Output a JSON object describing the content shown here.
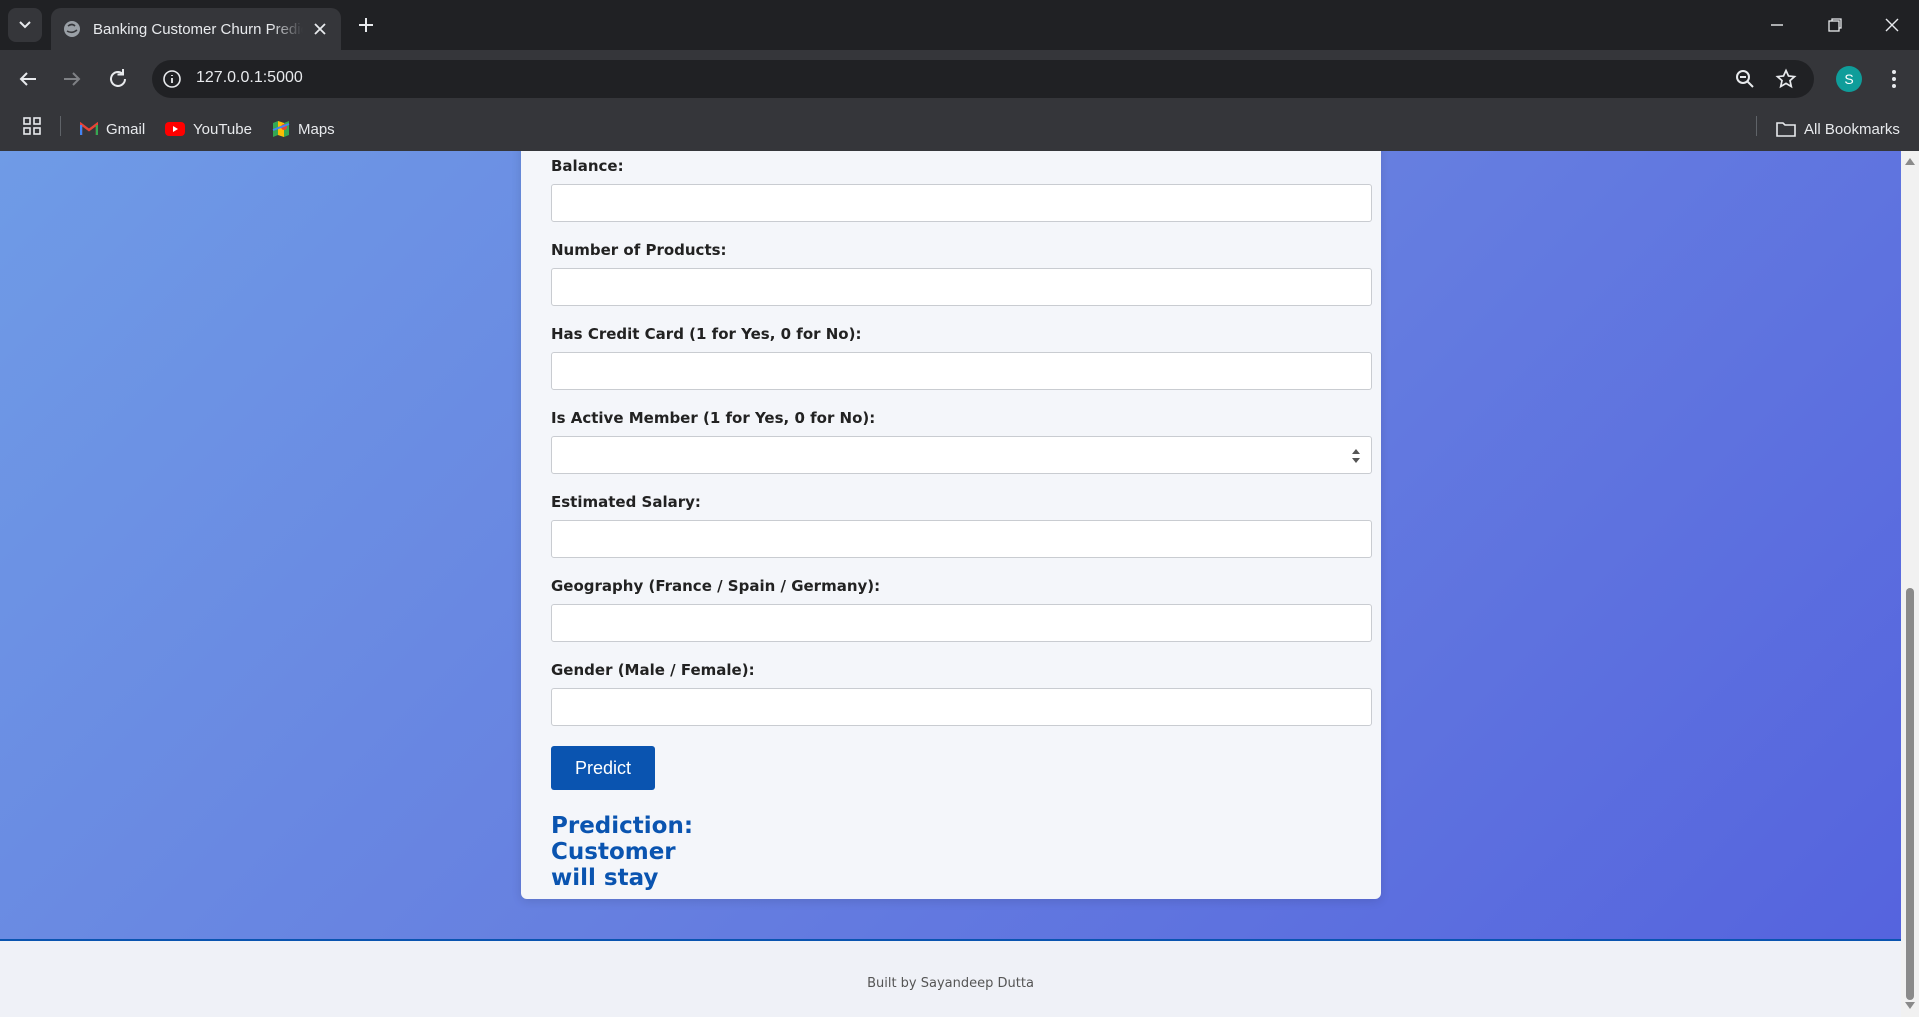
{
  "browser": {
    "tab_title": "Banking Customer Churn Prediction",
    "url": "127.0.0.1:5000",
    "profile_initial": "S",
    "bookmarks": [
      {
        "label": "Gmail"
      },
      {
        "label": "YouTube"
      },
      {
        "label": "Maps"
      }
    ],
    "all_bookmarks_label": "All Bookmarks"
  },
  "form": {
    "fields": [
      {
        "label": "Balance:",
        "value": ""
      },
      {
        "label": "Number of Products:",
        "value": ""
      },
      {
        "label": "Has Credit Card (1 for Yes, 0 for No):",
        "value": ""
      },
      {
        "label": "Is Active Member (1 for Yes, 0 for No):",
        "value": ""
      },
      {
        "label": "Estimated Salary:",
        "value": ""
      },
      {
        "label": "Geography (France / Spain / Germany):",
        "value": ""
      },
      {
        "label": "Gender (Male / Female):",
        "value": ""
      }
    ],
    "submit_label": "Predict",
    "prediction_text": "Prediction: Customer will stay"
  },
  "footer": {
    "text": "Built by Sayandeep Dutta"
  },
  "colors": {
    "primary": "#0a54b0",
    "bg_gradient_start": "#6f9be6",
    "bg_gradient_end": "#5462de"
  }
}
